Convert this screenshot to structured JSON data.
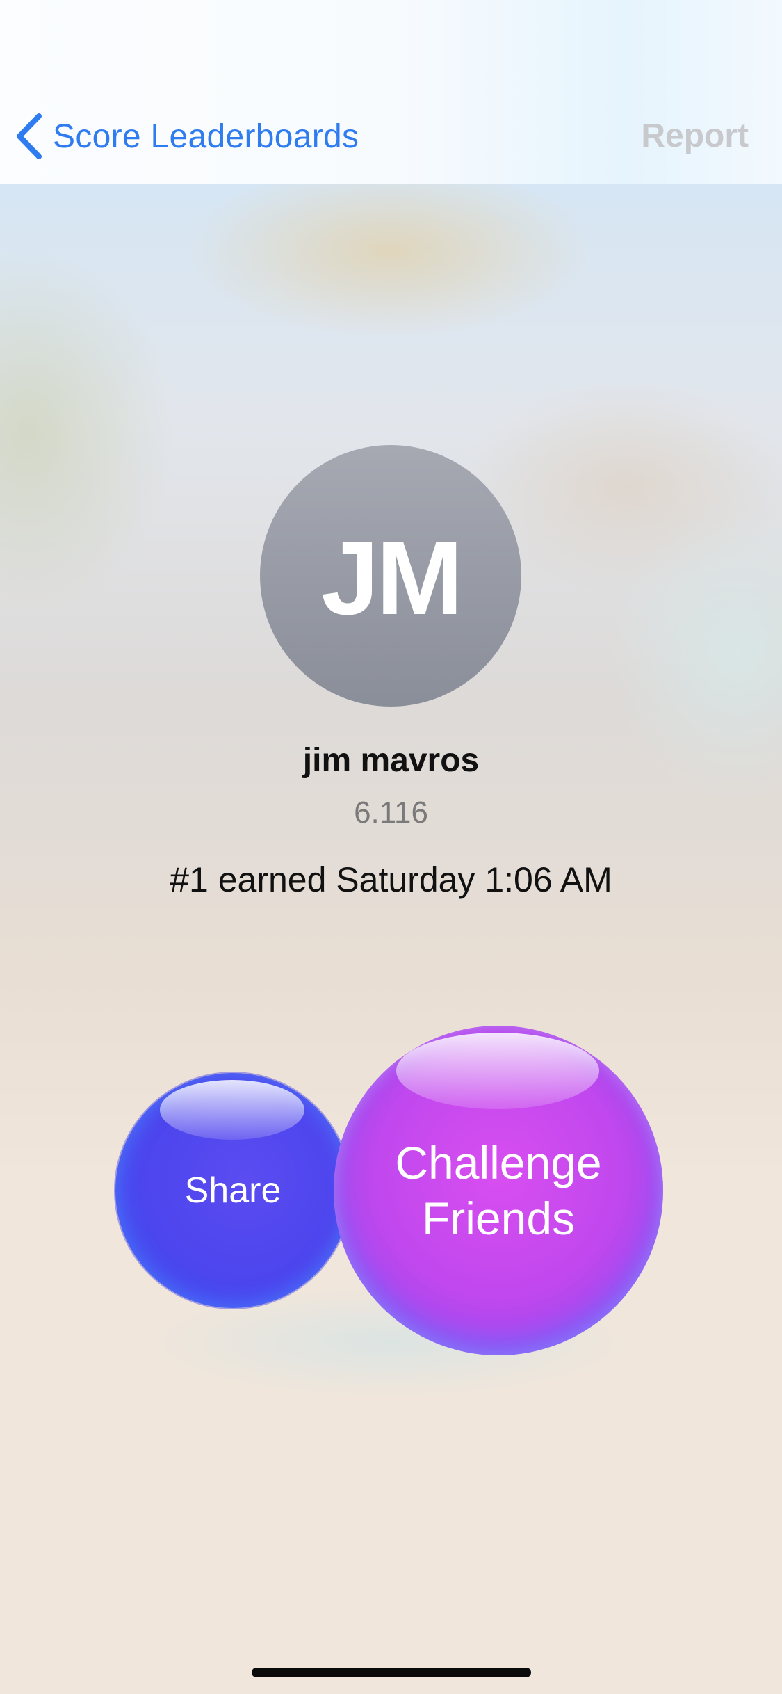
{
  "navbar": {
    "back_label": "Score Leaderboards",
    "report_label": "Report",
    "back_icon": "chevron-left-icon"
  },
  "player": {
    "initials": "JM",
    "name": "jim mavros",
    "score": "6.116",
    "rank_text": "#1 earned Saturday 1:06 AM"
  },
  "actions": {
    "share_label": "Share",
    "challenge_label": "Challenge Friends"
  },
  "colors": {
    "accent": "#2f7bf0",
    "avatar": "#9a9da6",
    "share_bubble": "#4d45ee",
    "challenge_bubble": "#c048ee"
  }
}
